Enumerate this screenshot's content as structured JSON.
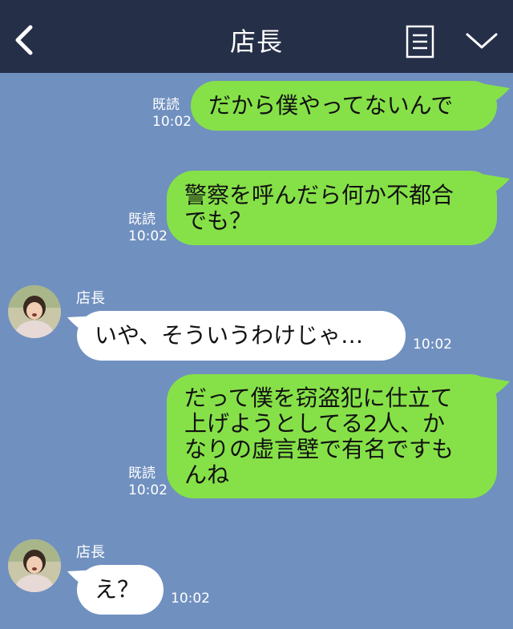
{
  "header": {
    "title": "店長",
    "back_icon": "chevron-left-icon",
    "menu_icon": "notes-icon",
    "expand_icon": "chevron-down-icon"
  },
  "colors": {
    "header_bg": "#252f48",
    "chat_bg": "#7090bf",
    "outgoing_bubble": "#86e148",
    "incoming_bubble": "#ffffff"
  },
  "messages": [
    {
      "direction": "out",
      "read": "既読",
      "time": "10:02",
      "text": "だから僕やってないんで"
    },
    {
      "direction": "out",
      "read": "既読",
      "time": "10:02",
      "text": "警察を呼んだら何か不都合\nでも？"
    },
    {
      "direction": "in",
      "sender": "店長",
      "time": "10:02",
      "text": "いや、そういうわけじゃ…"
    },
    {
      "direction": "out",
      "read": "既読",
      "time": "10:02",
      "text": "だって僕を窃盗犯に仕立て\n上げようとしてる2人、か\nなりの虚言壁で有名ですも\nんね"
    },
    {
      "direction": "in",
      "sender": "店長",
      "time": "10:02",
      "text": "え？"
    }
  ]
}
